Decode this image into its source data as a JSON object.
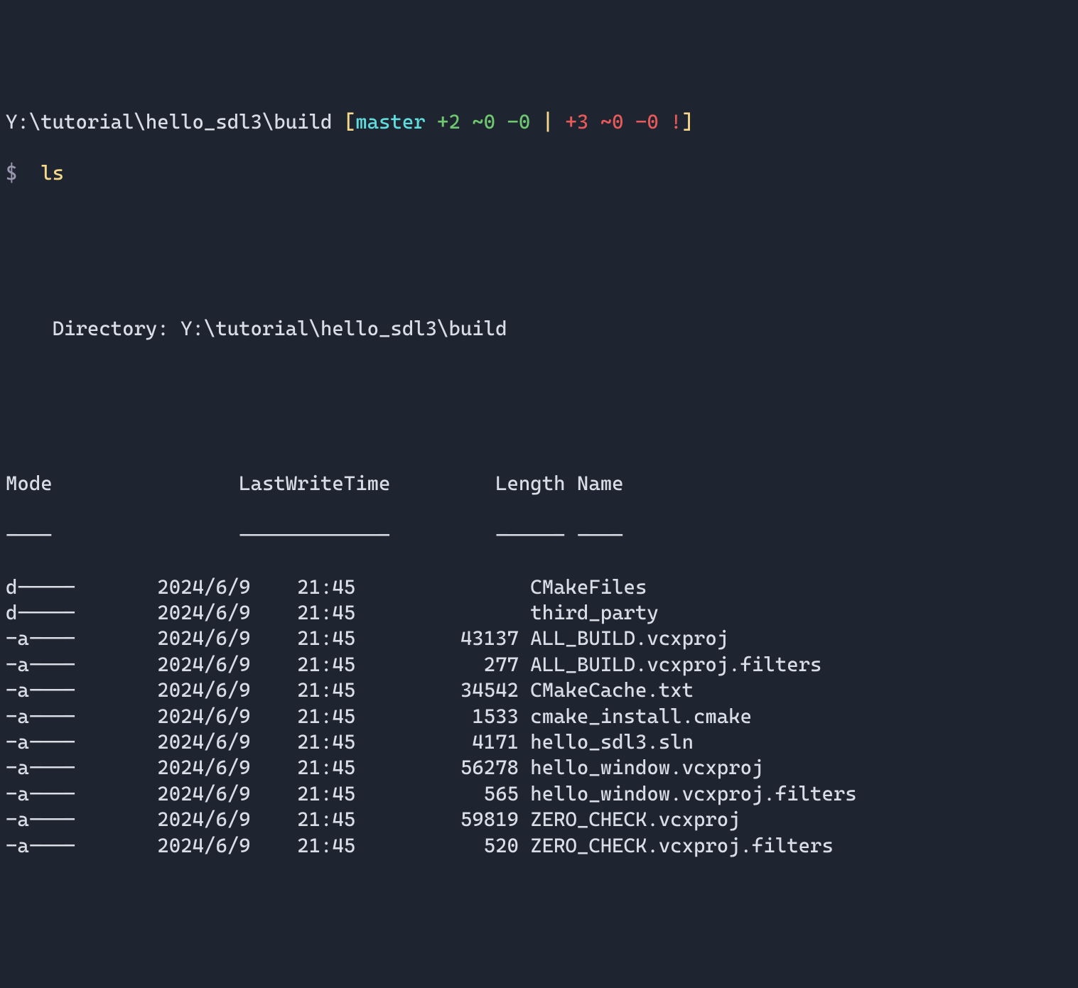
{
  "prompt": {
    "path": "Y:\\tutorial\\hello_sdl3\\build",
    "open_bracket": "[",
    "branch": "master",
    "staged_plus": "+2",
    "staged_tilde": "~0",
    "staged_minus": "-0",
    "separator": "|",
    "unstaged_plus": "+3",
    "unstaged_tilde": "~0",
    "unstaged_minus": "-0",
    "bang": "!",
    "close_bracket": "]",
    "dollar": "$",
    "command": "ls"
  },
  "dir_label": "Directory:",
  "dir_path": "Y:\\tutorial\\hello_sdl3\\build",
  "headers": {
    "mode": "Mode",
    "lwt": "LastWriteTime",
    "len": "Length",
    "name": "Name"
  },
  "dash": {
    "mode": "----",
    "lwt": "-------------",
    "len": "------",
    "name": "----"
  },
  "rows": [
    {
      "mode": "d-----",
      "date": "2024/6/9",
      "time": "21:45",
      "len": "",
      "name": "CMakeFiles"
    },
    {
      "mode": "d-----",
      "date": "2024/6/9",
      "time": "21:45",
      "len": "",
      "name": "third_party"
    },
    {
      "mode": "-a----",
      "date": "2024/6/9",
      "time": "21:45",
      "len": "43137",
      "name": "ALL_BUILD.vcxproj"
    },
    {
      "mode": "-a----",
      "date": "2024/6/9",
      "time": "21:45",
      "len": "277",
      "name": "ALL_BUILD.vcxproj.filters"
    },
    {
      "mode": "-a----",
      "date": "2024/6/9",
      "time": "21:45",
      "len": "34542",
      "name": "CMakeCache.txt"
    },
    {
      "mode": "-a----",
      "date": "2024/6/9",
      "time": "21:45",
      "len": "1533",
      "name": "cmake_install.cmake"
    },
    {
      "mode": "-a----",
      "date": "2024/6/9",
      "time": "21:45",
      "len": "4171",
      "name": "hello_sdl3.sln"
    },
    {
      "mode": "-a----",
      "date": "2024/6/9",
      "time": "21:45",
      "len": "56278",
      "name": "hello_window.vcxproj"
    },
    {
      "mode": "-a----",
      "date": "2024/6/9",
      "time": "21:45",
      "len": "565",
      "name": "hello_window.vcxproj.filters"
    },
    {
      "mode": "-a----",
      "date": "2024/6/9",
      "time": "21:45",
      "len": "59819",
      "name": "ZERO_CHECK.vcxproj"
    },
    {
      "mode": "-a----",
      "date": "2024/6/9",
      "time": "21:45",
      "len": "520",
      "name": "ZERO_CHECK.vcxproj.filters"
    }
  ]
}
